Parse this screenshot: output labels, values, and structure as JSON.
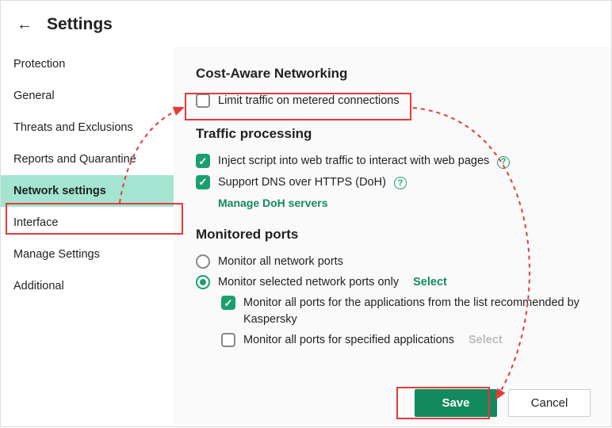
{
  "header": {
    "title": "Settings"
  },
  "sidebar": {
    "items": [
      {
        "label": "Protection"
      },
      {
        "label": "General"
      },
      {
        "label": "Threats and Exclusions"
      },
      {
        "label": "Reports and Quarantine"
      },
      {
        "label": "Network settings"
      },
      {
        "label": "Interface"
      },
      {
        "label": "Manage Settings"
      },
      {
        "label": "Additional"
      }
    ],
    "activeIndex": 4
  },
  "sections": {
    "costAware": {
      "heading": "Cost-Aware Networking",
      "limitTraffic": {
        "label": "Limit traffic on metered connections",
        "checked": false
      }
    },
    "trafficProcessing": {
      "heading": "Traffic processing",
      "injectScript": {
        "label": "Inject script into web traffic to interact with web pages",
        "checked": true
      },
      "supportDoh": {
        "label": "Support DNS over HTTPS (DoH)",
        "checked": true
      },
      "manageDoh": "Manage DoH servers"
    },
    "monitoredPorts": {
      "heading": "Monitored ports",
      "monitorAll": {
        "label": "Monitor all network ports"
      },
      "monitorSelected": {
        "label": "Monitor selected network ports only",
        "selectLabel": "Select"
      },
      "radioSelected": "selected",
      "subRecommended": {
        "label": "Monitor all ports for the applications from the list recommended by Kaspersky",
        "checked": true
      },
      "subSpecified": {
        "label": "Monitor all ports for specified applications",
        "checked": false,
        "selectLabel": "Select"
      }
    }
  },
  "footer": {
    "save": "Save",
    "cancel": "Cancel"
  }
}
